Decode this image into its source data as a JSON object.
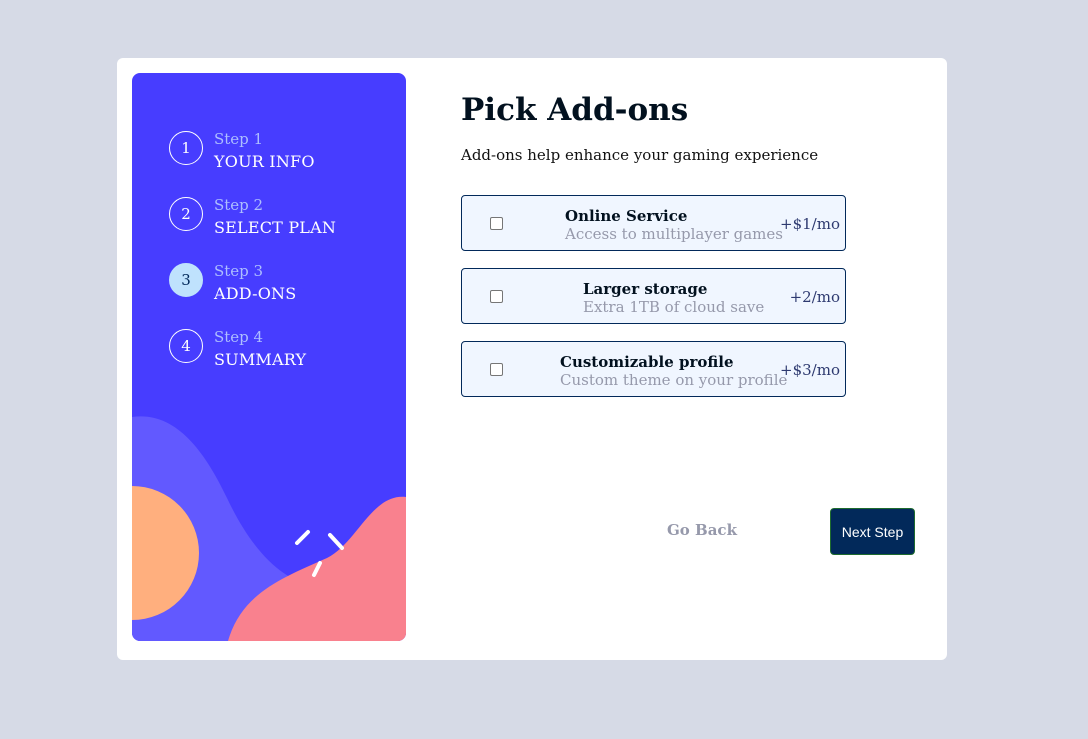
{
  "steps": [
    {
      "number": "1",
      "kicker": "Step 1",
      "title": "YOUR INFO",
      "active": false
    },
    {
      "number": "2",
      "kicker": "Step 2",
      "title": "SELECT PLAN",
      "active": false
    },
    {
      "number": "3",
      "kicker": "Step 3",
      "title": "ADD-ONS",
      "active": true
    },
    {
      "number": "4",
      "kicker": "Step 4",
      "title": "SUMMARY",
      "active": false
    }
  ],
  "main": {
    "title": "Pick Add-ons",
    "subtitle": "Add-ons help enhance your gaming experience"
  },
  "addons": [
    {
      "name": "Online Service",
      "description": "Access to multiplayer games",
      "price": "+$1/mo",
      "checked": false
    },
    {
      "name": "Larger storage",
      "description": "Extra 1TB of cloud save",
      "price": "+2/mo",
      "checked": false
    },
    {
      "name": "Customizable profile",
      "description": "Custom theme on your profile",
      "price": "+$3/mo",
      "checked": false
    }
  ],
  "buttons": {
    "back_label": "Go Back",
    "next_label": "Next Step"
  },
  "colors": {
    "sidebar": "#473dff",
    "active_step": "#bfe2fd",
    "primary": "#02295a",
    "addon_bg": "#f0f6ff",
    "muted": "#9699ab",
    "page_bg": "#d6dae6"
  }
}
